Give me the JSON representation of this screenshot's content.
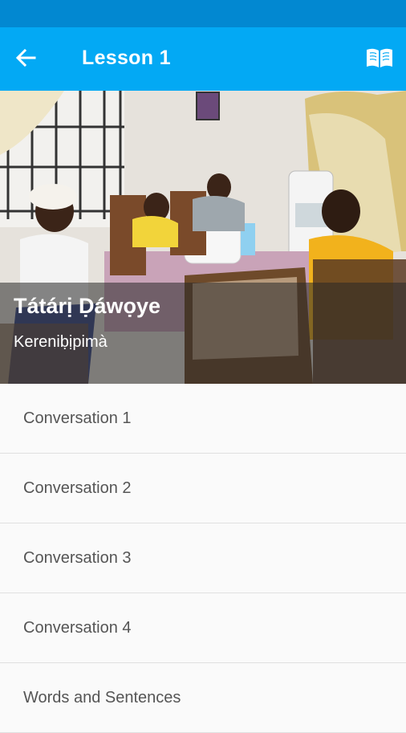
{
  "app_bar": {
    "title": "Lesson 1",
    "back_icon": "arrow-back-icon",
    "book_icon": "open-book-icon",
    "color": "#03a9f4",
    "status_color": "#0288d1"
  },
  "hero": {
    "title": "Tátárị Ḍáwọye",
    "subtitle": "Kereniḅịpimà"
  },
  "list": {
    "items": [
      {
        "label": "Conversation 1"
      },
      {
        "label": "Conversation 2"
      },
      {
        "label": "Conversation 3"
      },
      {
        "label": "Conversation 4"
      },
      {
        "label": "Words and Sentences"
      }
    ]
  }
}
